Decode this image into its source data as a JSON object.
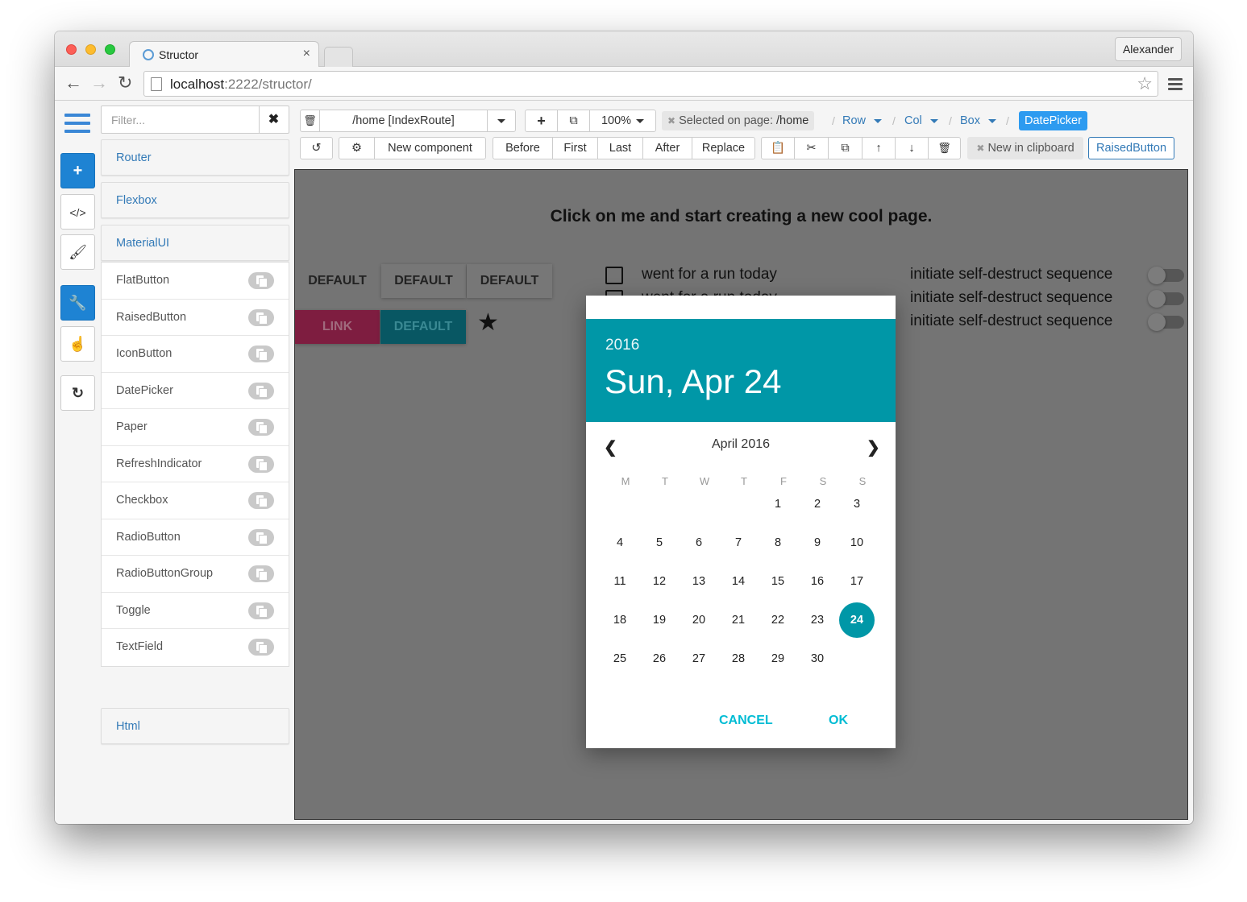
{
  "browser": {
    "tab_title": "Structor",
    "tab_close": "×",
    "profile": "Alexander",
    "url_host": "localhost",
    "url_path": ":2222/structor/"
  },
  "filter": {
    "placeholder": "Filter...",
    "clear": "✖"
  },
  "groups": {
    "router": "Router",
    "flexbox": "Flexbox",
    "materialui": "MaterialUI",
    "html": "Html"
  },
  "components": [
    "FlatButton",
    "RaisedButton",
    "IconButton",
    "DatePicker",
    "Paper",
    "RefreshIndicator",
    "Checkbox",
    "RadioButton",
    "RadioButtonGroup",
    "Toggle",
    "TextField"
  ],
  "toolbar1": {
    "route": "/home [IndexRoute]",
    "zoom": "100%",
    "selected_prefix": "Selected on page: ",
    "selected_page": "/home",
    "crumbs": [
      "Row",
      "Col",
      "Box"
    ],
    "active_crumb": "DatePicker"
  },
  "toolbar2": {
    "new_component": "New component",
    "positions": [
      "Before",
      "First",
      "Last",
      "After",
      "Replace"
    ],
    "clipboard_text": "New in clipboard",
    "clipboard_item": "RaisedButton"
  },
  "canvas": {
    "hero": "Click on me and start creating a new cool page.",
    "flat_buttons": [
      "DEFAULT",
      "DEFAULT",
      "DEFAULT"
    ],
    "link_button": "LINK",
    "default_button": "DEFAULT",
    "checkbox_label": "went for a run today",
    "toggle_label": "initiate self-destruct sequence"
  },
  "datepicker": {
    "year": "2016",
    "date": "Sun, Apr 24",
    "month": "April 2016",
    "weekdays": [
      "M",
      "T",
      "W",
      "T",
      "F",
      "S",
      "S"
    ],
    "first_weekday_index": 4,
    "days_in_month": 30,
    "selected_day": 24,
    "cancel": "CANCEL",
    "ok": "OK"
  },
  "colors": {
    "accent": "#0097a7",
    "primary_blue": "#1e83d3",
    "link_blue": "#337ab7"
  }
}
